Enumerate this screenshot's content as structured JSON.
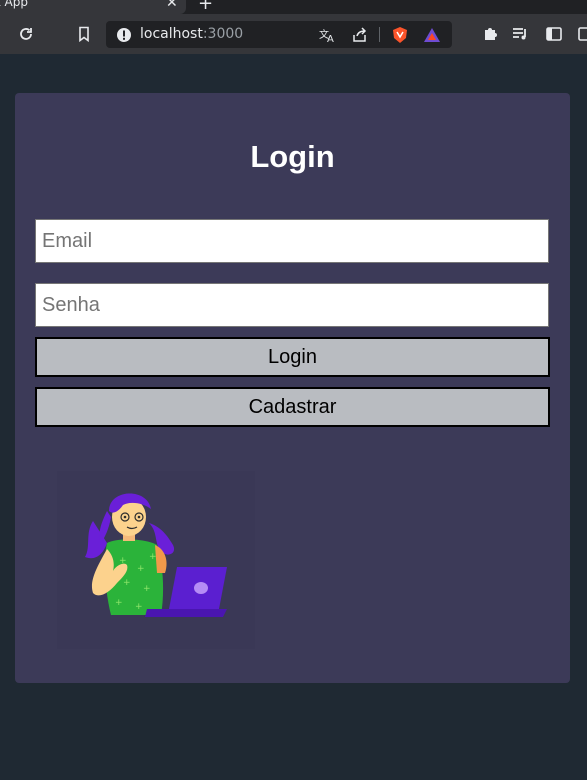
{
  "browser": {
    "tab_title": "t App",
    "url_host": "localhost",
    "url_port": ":3000"
  },
  "login": {
    "title": "Login",
    "email_placeholder": "Email",
    "password_placeholder": "Senha",
    "login_button": "Login",
    "register_button": "Cadastrar"
  },
  "colors": {
    "page_bg": "#1f2933",
    "card_bg": "#3c3a58",
    "button_bg": "#b9bcc1"
  },
  "icons": [
    "reload-icon",
    "bookmark-icon",
    "info-icon",
    "translate-icon",
    "share-icon",
    "brave-shield-icon",
    "brave-rewards-icon",
    "extensions-icon",
    "media-queue-icon",
    "sidebar-icon"
  ]
}
